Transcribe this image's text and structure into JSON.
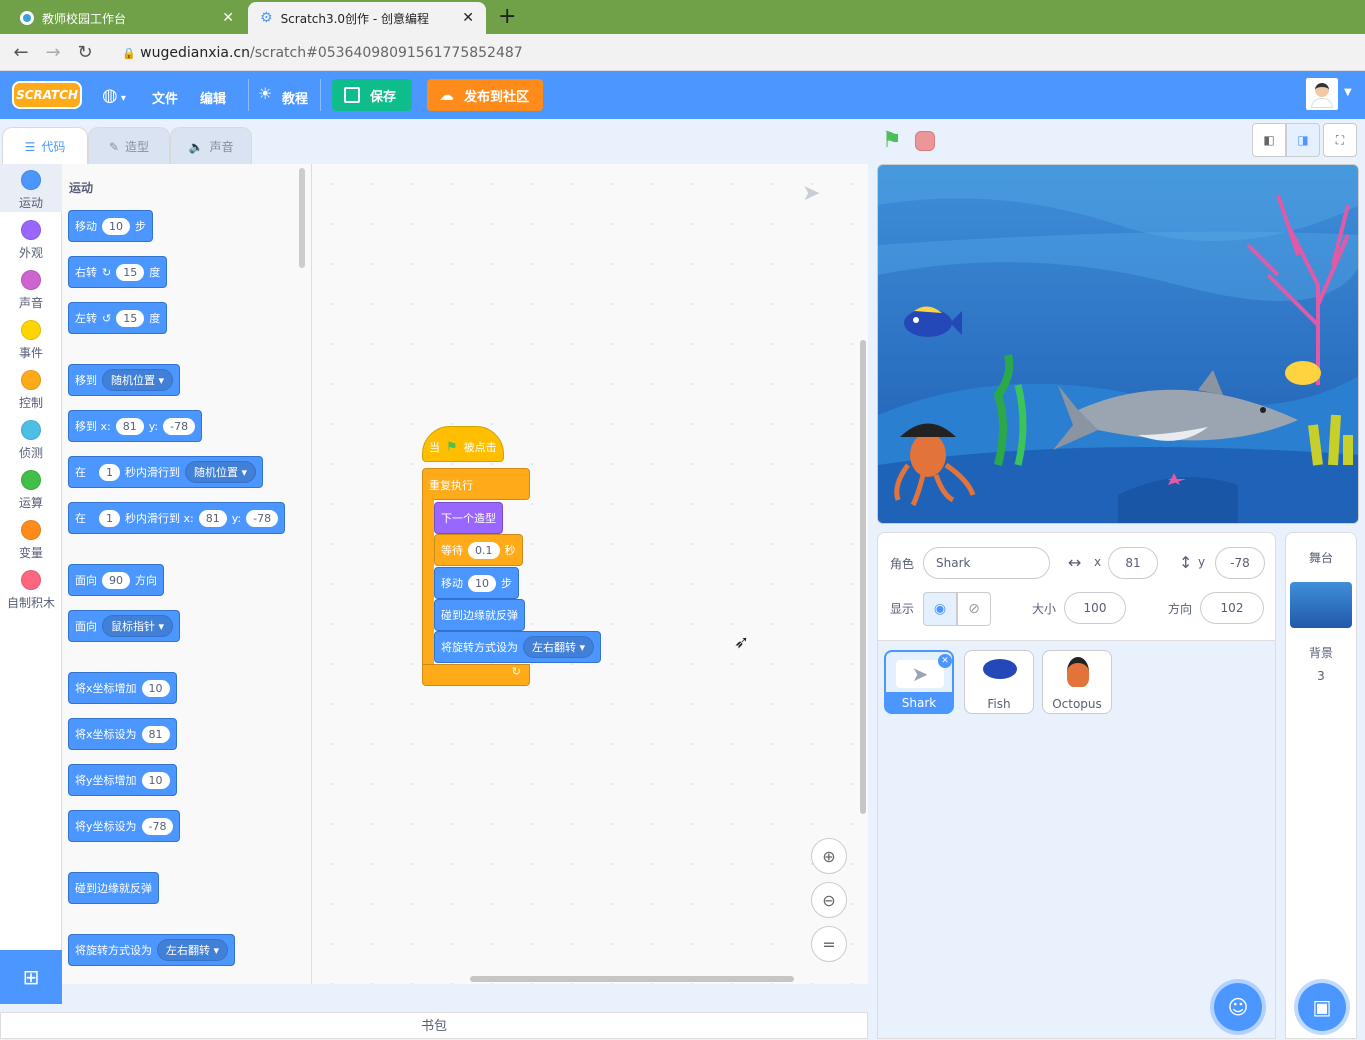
{
  "browser": {
    "tabs": [
      {
        "title": "教师校园工作台",
        "active": false
      },
      {
        "title": "Scratch3.0创作 - 创意编程",
        "active": true
      }
    ],
    "new_tab": "+",
    "url_host": "wugedianxia.cn",
    "url_path": "/scratch#0536409809156177585248​7"
  },
  "menu": {
    "logo": "SCRATCH",
    "file": "文件",
    "edit": "编辑",
    "tutorial": "教程",
    "save": "保存",
    "publish": "发布到社区"
  },
  "editor_tabs": {
    "code": "代码",
    "costumes": "造型",
    "sounds": "声音"
  },
  "categories": [
    {
      "label": "运动",
      "color": "#4c97ff"
    },
    {
      "label": "外观",
      "color": "#9966ff"
    },
    {
      "label": "声音",
      "color": "#cf63cf"
    },
    {
      "label": "事件",
      "color": "#ffd500"
    },
    {
      "label": "控制",
      "color": "#ffab19"
    },
    {
      "label": "侦测",
      "color": "#4cbfe6"
    },
    {
      "label": "运算",
      "color": "#40bf4a"
    },
    {
      "label": "变量",
      "color": "#ff8c1a"
    },
    {
      "label": "自制积木",
      "color": "#ff6680"
    }
  ],
  "palette": {
    "heading": "运动",
    "move": {
      "a": "移动",
      "v": "10",
      "b": "步"
    },
    "turn_right": {
      "a": "右转",
      "v": "15",
      "b": "度"
    },
    "turn_left": {
      "a": "左转",
      "v": "15",
      "b": "度"
    },
    "goto": {
      "a": "移到",
      "d": "随机位置"
    },
    "gotoxy": {
      "a": "移到 x:",
      "x": "81",
      "yl": "y:",
      "y": "-78"
    },
    "glide": {
      "a": "在",
      "v": "1",
      "b": "秒内滑行到",
      "d": "随机位置"
    },
    "glidexy": {
      "a": "在",
      "v": "1",
      "b": "秒内滑行到 x:",
      "x": "81",
      "yl": "y:",
      "y": "-78"
    },
    "point": {
      "a": "面向",
      "v": "90",
      "b": "方向"
    },
    "pointto": {
      "a": "面向",
      "d": "鼠标指针"
    },
    "changex": {
      "a": "将x坐标增加",
      "v": "10"
    },
    "setx": {
      "a": "将x坐标设为",
      "v": "81"
    },
    "changey": {
      "a": "将y坐标增加",
      "v": "10"
    },
    "sety": {
      "a": "将y坐标设为",
      "v": "-78"
    },
    "bounce": {
      "a": "碰到边缘就反弹"
    },
    "rotstyle": {
      "a": "将旋转方式设为",
      "d": "左右翻转"
    }
  },
  "script": {
    "hat": {
      "a": "当",
      "b": "被点击"
    },
    "forever": "重复执行",
    "next_costume": "下一个造型",
    "wait": {
      "a": "等待",
      "v": "0.1",
      "b": "秒"
    },
    "move": {
      "a": "移动",
      "v": "10",
      "b": "步"
    },
    "bounce": "碰到边缘就反弹",
    "rotstyle": {
      "a": "将旋转方式设为",
      "d": "左右翻转"
    }
  },
  "backpack": "书包",
  "sprite_info": {
    "sprite_label": "角色",
    "sprite_name": "Shark",
    "x_label": "x",
    "x": "81",
    "y_label": "y",
    "y": "-78",
    "show_label": "显示",
    "size_label": "大小",
    "size": "100",
    "direction_label": "方向",
    "direction": "102"
  },
  "sprites": [
    {
      "name": "Shark",
      "selected": true
    },
    {
      "name": "Fish",
      "selected": false
    },
    {
      "name": "Octopus",
      "selected": false
    }
  ],
  "stage_panel": {
    "title": "舞台",
    "backdrops_label": "背景",
    "backdrops_count": "3"
  }
}
